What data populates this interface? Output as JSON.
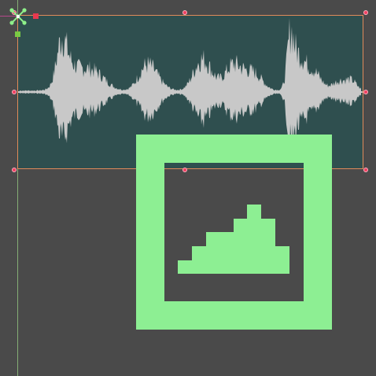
{
  "editor": {
    "guide_color": "#8ec07c",
    "selection_color": "#e08a5a",
    "handle_color": "#f04060"
  },
  "clip": {
    "type": "audio",
    "background": "#2f4f4f",
    "waveform_color": "#c8c8c8"
  },
  "icons": {
    "pivot": "move-pivot-icon",
    "badge": "audio-waveform-file-icon",
    "badge_color": "#8def93"
  }
}
